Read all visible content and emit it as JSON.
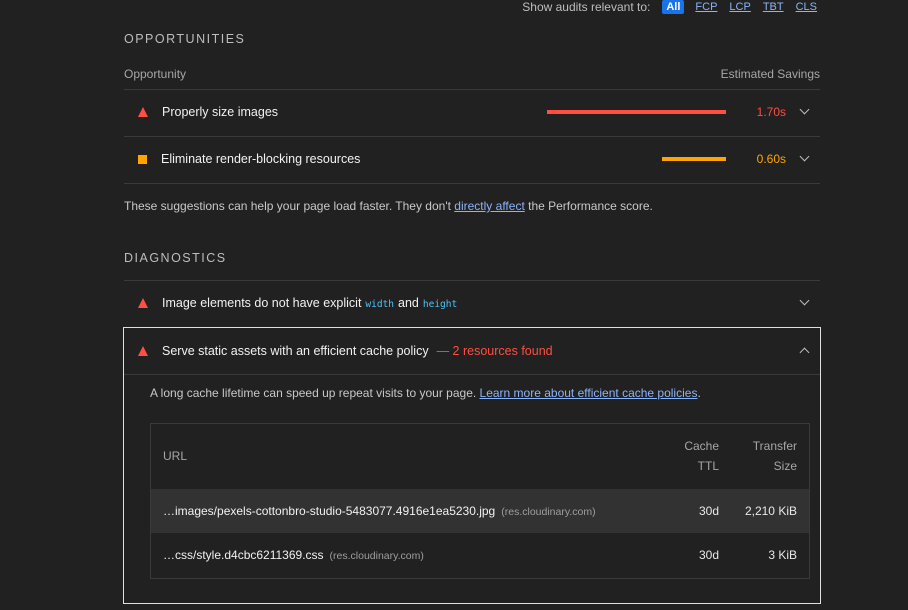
{
  "filter": {
    "label": "Show audits relevant to:",
    "chips": [
      "All",
      "FCP",
      "LCP",
      "TBT",
      "CLS"
    ]
  },
  "opportunities": {
    "section_title": "OPPORTUNITIES",
    "col_opportunity": "Opportunity",
    "col_savings": "Estimated Savings",
    "items": [
      {
        "title": "Properly size images",
        "savings": "1.70s",
        "severity": "fail",
        "color": "#ff4e42"
      },
      {
        "title": "Eliminate render-blocking resources",
        "savings": "0.60s",
        "severity": "average",
        "color": "#ffa400"
      }
    ],
    "note_prefix": "These suggestions can help your page load faster. They don't ",
    "note_link": "directly affect",
    "note_suffix": " the Performance score."
  },
  "diagnostics": {
    "section_title": "DIAGNOSTICS",
    "item1": {
      "title_prefix": "Image elements do not have explicit",
      "attr1": "width",
      "and": "and",
      "attr2": "height"
    },
    "item2": {
      "title": "Serve static assets with an efficient cache policy",
      "count": "— 2 resources found",
      "desc_prefix": "A long cache lifetime can speed up repeat visits to your page. ",
      "desc_link": "Learn more about efficient cache policies",
      "desc_suffix": ".",
      "table": {
        "col_url": "URL",
        "col_ttl_1": "Cache",
        "col_ttl_2": "TTL",
        "col_size_1": "Transfer",
        "col_size_2": "Size",
        "rows": [
          {
            "url": "…images/pexels-cottonbro-studio-5483077.4916e1ea5230.jpg",
            "host": "(res.cloudinary.com)",
            "ttl": "30d",
            "size": "2,210 KiB"
          },
          {
            "url": "…css/style.d4cbc6211369.css",
            "host": "(res.cloudinary.com)",
            "ttl": "30d",
            "size": "3 KiB"
          }
        ]
      }
    }
  },
  "colors": {
    "fail": "#ff4e42",
    "average": "#ffa400",
    "link": "#8ab4f8",
    "accent": "#1a73e8"
  }
}
